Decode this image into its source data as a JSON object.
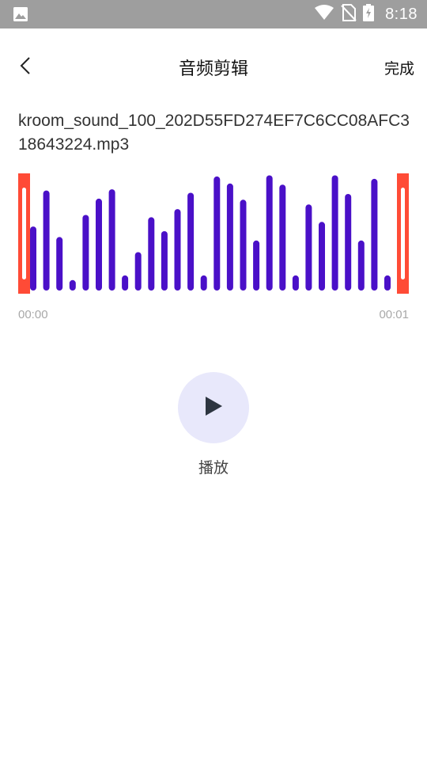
{
  "status_bar": {
    "time": "8:18",
    "icons": [
      "image-icon",
      "wifi-icon",
      "no-sim-icon",
      "battery-charging-icon"
    ]
  },
  "header": {
    "title": "音频剪辑",
    "done_label": "完成",
    "back_icon": "chevron-left-icon"
  },
  "file": {
    "name": "kroom_sound_100_202D55FD274EF7C6CC08AFC318643224.mp3"
  },
  "waveform": {
    "bar_color": "#4a10c8",
    "handle_color": "#ff4b36",
    "levels": [
      0.55,
      0.86,
      0.46,
      0.09,
      0.65,
      0.79,
      0.87,
      0.13,
      0.33,
      0.63,
      0.51,
      0.7,
      0.84,
      0.13,
      0.98,
      0.92,
      0.78,
      0.43,
      0.99,
      0.91,
      0.13,
      0.74,
      0.59,
      0.99,
      0.83,
      0.43,
      0.96,
      0.13
    ]
  },
  "timeline": {
    "start": "00:00",
    "end": "00:01"
  },
  "playback": {
    "play_label": "播放",
    "play_icon": "play-icon"
  }
}
